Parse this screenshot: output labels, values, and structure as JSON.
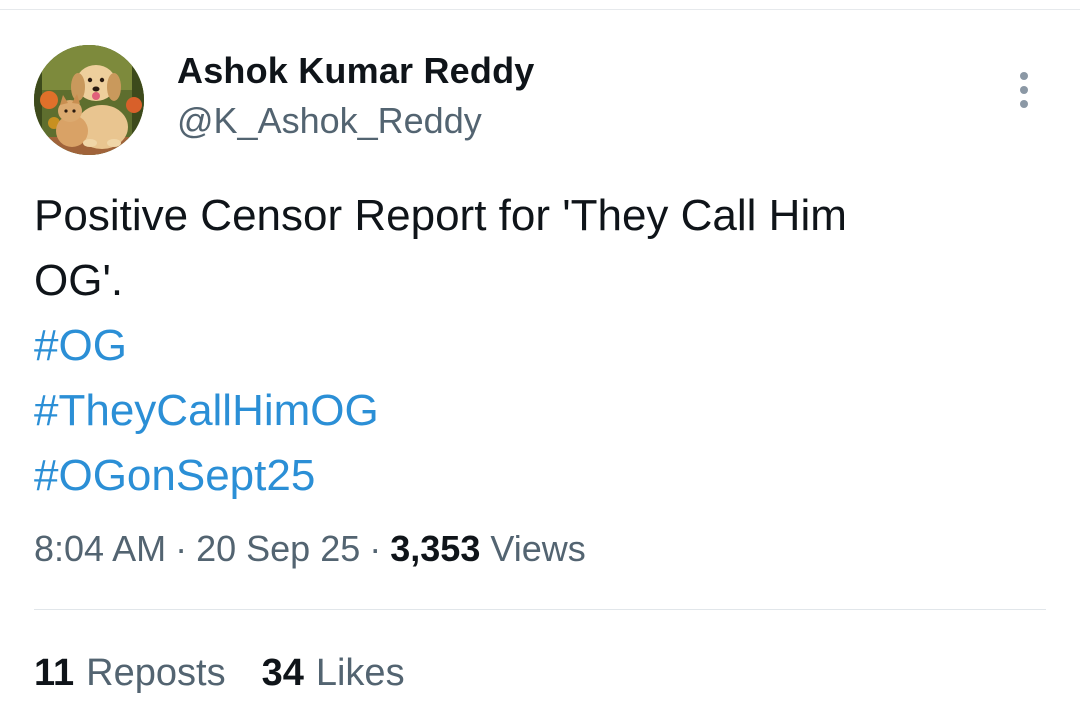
{
  "author": {
    "name": "Ashok Kumar Reddy",
    "handle": "@K_Ashok_Reddy"
  },
  "tweet": {
    "text_lines": [
      "Positive Censor Report for 'They Call Him",
      "OG'."
    ],
    "hashtags": [
      "#OG",
      "#TheyCallHimOG",
      "#OGonSept25"
    ]
  },
  "meta": {
    "time": "8:04 AM",
    "separator": "·",
    "date": "20 Sep 25",
    "views_count": "3,353",
    "views_label": "Views"
  },
  "stats": {
    "reposts_count": "11",
    "reposts_label": "Reposts",
    "likes_count": "34",
    "likes_label": "Likes"
  },
  "icons": {
    "avatar": "puppy-and-kitten-photo",
    "more": "more-vertical-icon"
  },
  "colors": {
    "hashtag": "#2b8fd6",
    "text": "#0f1419",
    "secondary_text": "#536471",
    "divider": "#e1e6ea"
  }
}
